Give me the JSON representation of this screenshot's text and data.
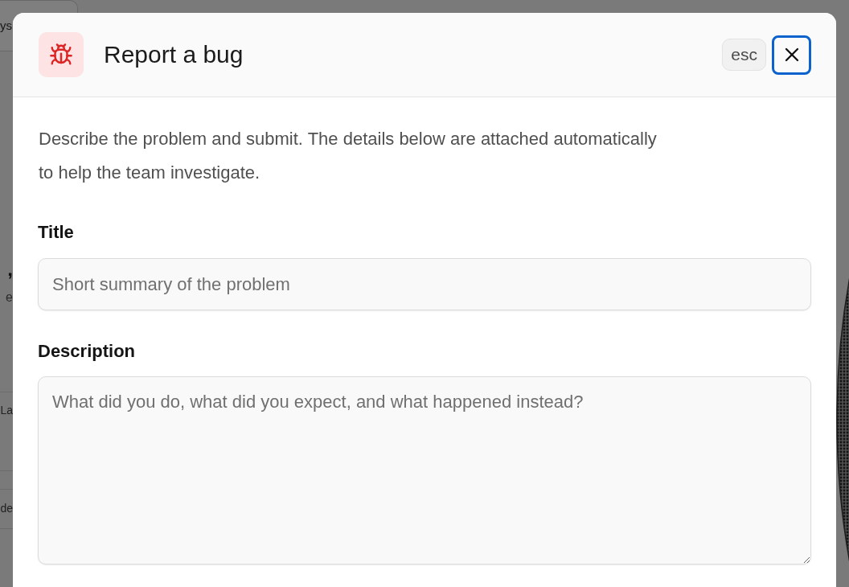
{
  "background": {
    "toolbar_button": "ys",
    "heading": ",",
    "subtitle": "e",
    "rows": [
      "La",
      "de"
    ]
  },
  "dialog": {
    "title": "Report a bug",
    "shortcut": "esc",
    "close_button": {
      "focused": true
    },
    "intro": "Describe the problem and submit. The details below are attached automatically to help the team investigate.",
    "fields": [
      {
        "kind": "input",
        "label": "Title",
        "placeholder": "Short summary of the problem"
      },
      {
        "kind": "textarea",
        "label": "Description",
        "placeholder": "What did you do, what did you expect, and what happened instead?"
      }
    ]
  }
}
